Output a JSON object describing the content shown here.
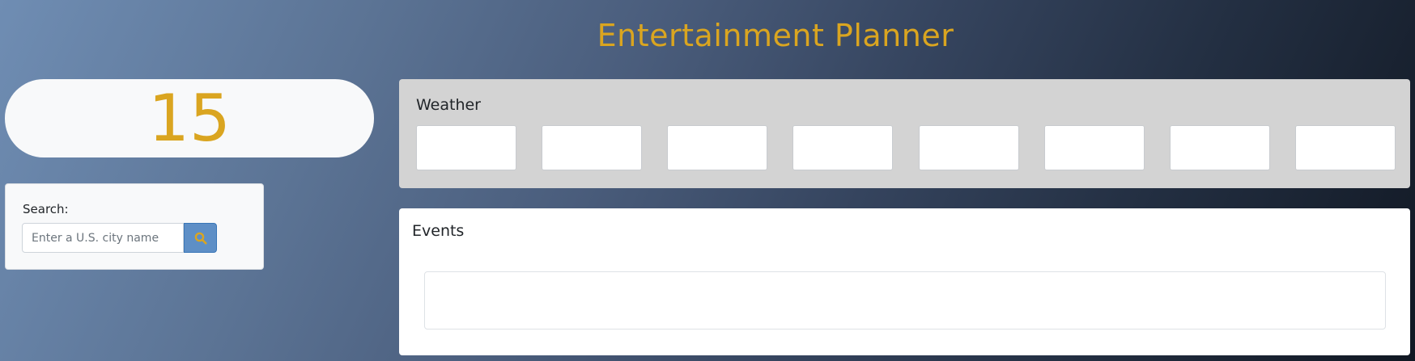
{
  "header": {
    "title": "Entertainment Planner"
  },
  "counter": {
    "value": "15"
  },
  "search": {
    "label": "Search:",
    "placeholder": "Enter a U.S. city name",
    "value": "",
    "button_icon": "search-icon"
  },
  "weather": {
    "title": "Weather",
    "days": [
      "",
      "",
      "",
      "",
      "",
      "",
      "",
      ""
    ]
  },
  "events": {
    "title": "Events",
    "items": []
  },
  "colors": {
    "accent": "#daa520",
    "search_button": "#5e8fc6",
    "weather_panel": "#d3d3d3",
    "card": "#f8f9fa"
  }
}
